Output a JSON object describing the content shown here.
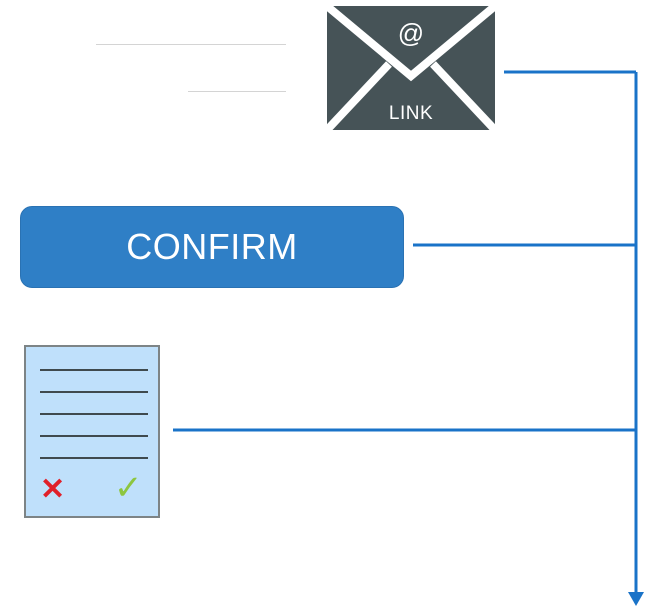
{
  "envelope": {
    "symbol": "@",
    "label": "LINK",
    "icon": "email-envelope-icon",
    "background_color": "#465357"
  },
  "confirm_button": {
    "label": "CONFIRM",
    "background_color": "#2f7fc6"
  },
  "form_document": {
    "icon": "document-form-icon",
    "reject_mark": "✕",
    "accept_mark": "✓",
    "background_color": "#bfe0fb",
    "reject_color": "#e0202a",
    "accept_color": "#8dc63f"
  },
  "connectors": {
    "color": "#1a73c8",
    "arrow_direction": "down"
  }
}
